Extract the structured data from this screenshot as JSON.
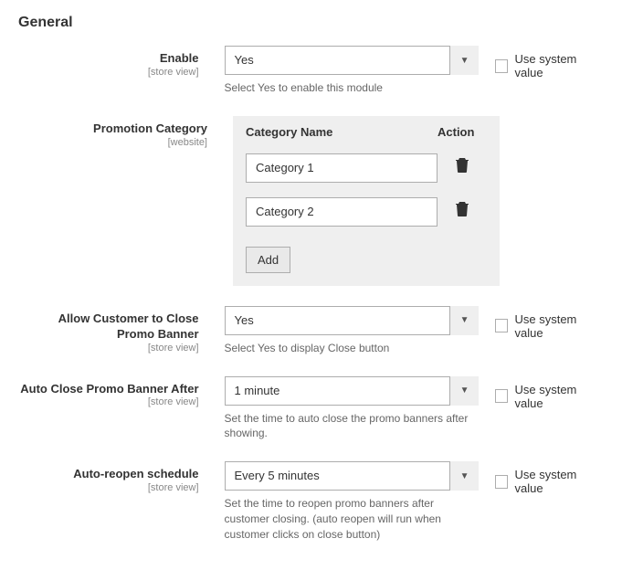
{
  "section": {
    "title": "General"
  },
  "scopes": {
    "store_view": "[store view]",
    "website": "[website]"
  },
  "system_value_label": "Use system value",
  "fields": {
    "enable": {
      "label": "Enable",
      "value": "Yes",
      "note": "Select Yes to enable this module"
    },
    "promotion_category": {
      "label": "Promotion Category",
      "header_name": "Category Name",
      "header_action": "Action",
      "rows": [
        "Category 1",
        "Category 2"
      ],
      "add_label": "Add"
    },
    "allow_close": {
      "label": "Allow Customer to Close Promo Banner",
      "value": "Yes",
      "note": "Select Yes to display Close button"
    },
    "auto_close_after": {
      "label": "Auto Close Promo Banner After",
      "value": "1 minute",
      "note": "Set the time to auto close the promo banners after showing."
    },
    "auto_reopen": {
      "label": "Auto-reopen schedule",
      "value": "Every 5 minutes",
      "note": "Set the time to reopen promo banners after customer closing. (auto reopen will run when customer clicks on close button)"
    }
  }
}
